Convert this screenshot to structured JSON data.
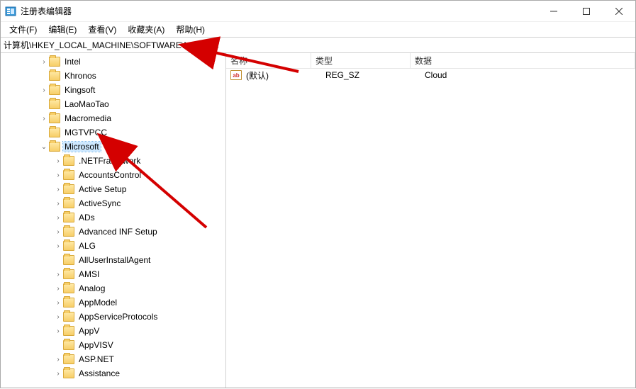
{
  "window": {
    "title": "注册表编辑器"
  },
  "menu": {
    "file": "文件(F)",
    "edit": "编辑(E)",
    "view": "查看(V)",
    "fav": "收藏夹(A)",
    "help": "帮助(H)"
  },
  "address": "计算机\\HKEY_LOCAL_MACHINE\\SOFTWARE\\Microsoft",
  "tree": [
    {
      "label": "Intel",
      "indent": 54,
      "exp": ">"
    },
    {
      "label": "Khronos",
      "indent": 54,
      "exp": ""
    },
    {
      "label": "Kingsoft",
      "indent": 54,
      "exp": ">"
    },
    {
      "label": "LaoMaoTao",
      "indent": 54,
      "exp": ""
    },
    {
      "label": "Macromedia",
      "indent": 54,
      "exp": ">"
    },
    {
      "label": "MGTVPCC",
      "indent": 54,
      "exp": ""
    },
    {
      "label": "Microsoft",
      "indent": 54,
      "exp": "v",
      "selected": true
    },
    {
      "label": ".NETFramework",
      "indent": 74,
      "exp": ">"
    },
    {
      "label": "AccountsControl",
      "indent": 74,
      "exp": ">"
    },
    {
      "label": "Active Setup",
      "indent": 74,
      "exp": ">"
    },
    {
      "label": "ActiveSync",
      "indent": 74,
      "exp": ">"
    },
    {
      "label": "ADs",
      "indent": 74,
      "exp": ">"
    },
    {
      "label": "Advanced INF Setup",
      "indent": 74,
      "exp": ">"
    },
    {
      "label": "ALG",
      "indent": 74,
      "exp": ">"
    },
    {
      "label": "AllUserInstallAgent",
      "indent": 74,
      "exp": ""
    },
    {
      "label": "AMSI",
      "indent": 74,
      "exp": ">"
    },
    {
      "label": "Analog",
      "indent": 74,
      "exp": ">"
    },
    {
      "label": "AppModel",
      "indent": 74,
      "exp": ">"
    },
    {
      "label": "AppServiceProtocols",
      "indent": 74,
      "exp": ">"
    },
    {
      "label": "AppV",
      "indent": 74,
      "exp": ">"
    },
    {
      "label": "AppVISV",
      "indent": 74,
      "exp": ""
    },
    {
      "label": "ASP.NET",
      "indent": 74,
      "exp": ">"
    },
    {
      "label": "Assistance",
      "indent": 74,
      "exp": ">"
    }
  ],
  "list": {
    "headers": {
      "name": "名称",
      "type": "类型",
      "data": "数据"
    },
    "rows": [
      {
        "name": "(默认)",
        "type": "REG_SZ",
        "data": "Cloud",
        "icon_label": "ab"
      }
    ]
  }
}
